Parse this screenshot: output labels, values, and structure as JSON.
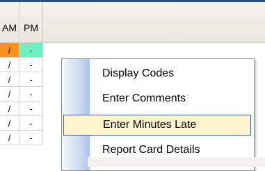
{
  "grid": {
    "columns": [
      "AM",
      "PM"
    ],
    "rows": [
      {
        "am": "/",
        "pm": "-"
      },
      {
        "am": "/",
        "pm": "-"
      },
      {
        "am": "/",
        "pm": "-"
      },
      {
        "am": "/",
        "pm": "-"
      },
      {
        "am": "/",
        "pm": "-"
      },
      {
        "am": "/",
        "pm": "-"
      },
      {
        "am": "/",
        "pm": "-"
      }
    ]
  },
  "context_menu": {
    "items": [
      {
        "label": "Display Codes"
      },
      {
        "label": "Enter Comments"
      },
      {
        "label": "Enter Minutes Late",
        "highlighted": true
      },
      {
        "label": "Report Card Details"
      }
    ]
  },
  "colors": {
    "am_highlight": "#f7941d",
    "pm_highlight": "#6ff0c0",
    "menu_highlight_bg": "#fff4cd",
    "menu_highlight_border": "#3b5fbd"
  }
}
